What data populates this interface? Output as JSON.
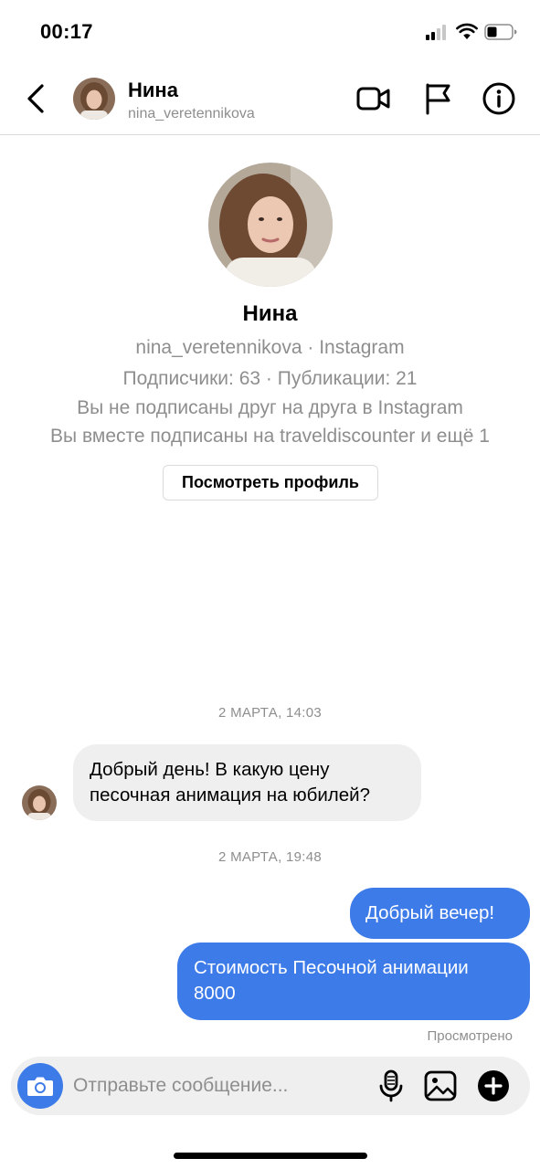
{
  "status_bar": {
    "time": "00:17"
  },
  "header": {
    "name": "Нина",
    "username": "nina_veretennikova"
  },
  "profile": {
    "name": "Нина",
    "username_line": "nina_veretennikova · Instagram",
    "stats_line": "Подписчики: 63 · Публикации: 21",
    "follow_line": "Вы не подписаны друг на друга в Instagram",
    "mutual_line": "Вы вместе подписаны на traveldiscounter и ещё 1",
    "view_profile_label": "Посмотреть профиль"
  },
  "messages": {
    "date1": "2 МАРТА, 14:03",
    "incoming": [
      "Добрый день! В какую цену",
      "песочная анимация на юбилей?"
    ],
    "date2": "2 МАРТА, 19:48",
    "outgoing1": "Добрый вечер!",
    "outgoing2": [
      "Стоимость Песочной анимации",
      "8000"
    ],
    "seen": "Просмотрено"
  },
  "composer": {
    "placeholder": "Отправьте сообщение..."
  },
  "colors": {
    "accent": "#3d7be8",
    "muted": "#8e8e8e",
    "incoming_bubble": "#efefef"
  }
}
